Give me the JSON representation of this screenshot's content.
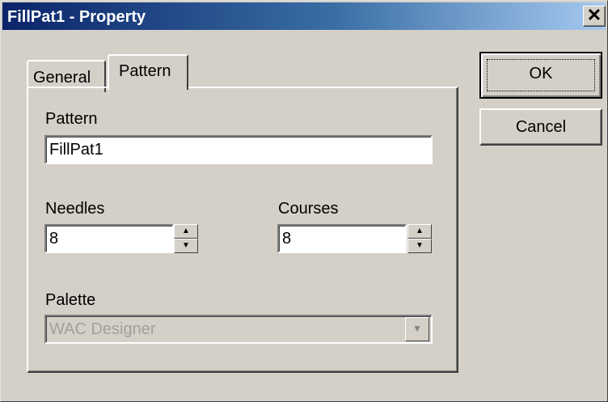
{
  "window": {
    "title": "FillPat1 - Property",
    "close_glyph": "✕"
  },
  "tabs": [
    {
      "label": "General"
    },
    {
      "label": "Pattern"
    }
  ],
  "pattern": {
    "label": "Pattern",
    "value": "FillPat1"
  },
  "needles": {
    "label": "Needles",
    "value": "8"
  },
  "courses": {
    "label": "Courses",
    "value": "8"
  },
  "palette": {
    "label": "Palette",
    "value": "WAC Designer"
  },
  "buttons": {
    "ok": "OK",
    "cancel": "Cancel"
  },
  "colors": {
    "title_start": "#0a246a",
    "title_end": "#a6caf0",
    "face": "#d4d0c8"
  },
  "icons": {
    "close": "close-icon",
    "spin_up": "spin-up-icon",
    "spin_down": "spin-down-icon",
    "dropdown": "chevron-down-icon"
  }
}
